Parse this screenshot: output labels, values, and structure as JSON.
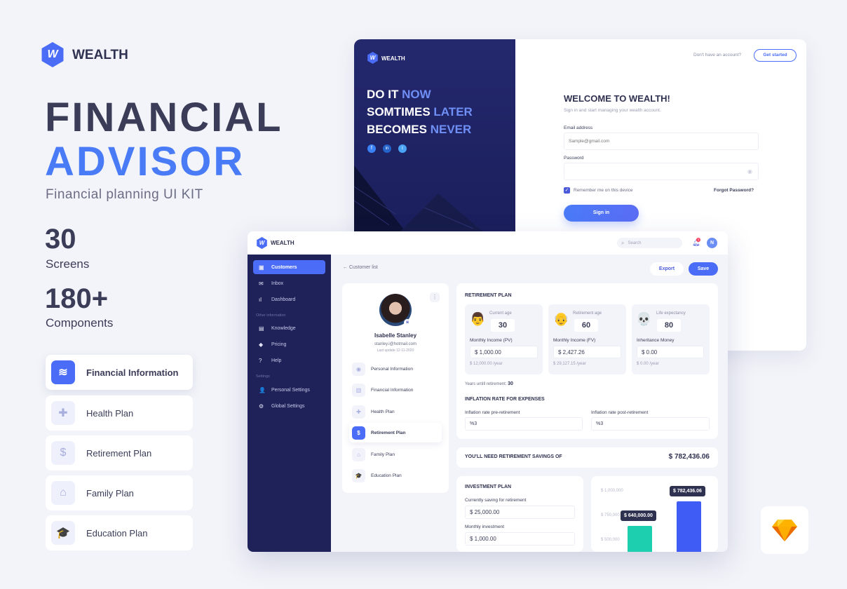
{
  "brand": {
    "name": "WEALTH",
    "logo_letter": "W"
  },
  "hero": {
    "line1": "FINANCIAL",
    "line2": "ADVISOR",
    "tagline": "Financial planning UI KIT",
    "stat1_value": "30",
    "stat1_label": "Screens",
    "stat2_value": "180+",
    "stat2_label": "Components"
  },
  "features": [
    {
      "label": "Financial Information",
      "icon": "coins-icon",
      "active": true
    },
    {
      "label": "Health Plan",
      "icon": "plus-icon"
    },
    {
      "label": "Retirement Plan",
      "icon": "briefcase-dollar-icon"
    },
    {
      "label": "Family Plan",
      "icon": "house-heart-icon"
    },
    {
      "label": "Education Plan",
      "icon": "graduation-cap-icon"
    }
  ],
  "login": {
    "slogan": [
      {
        "white": "DO IT",
        "accent": "NOW"
      },
      {
        "white": "SOMTIMES",
        "accent": "LATER"
      },
      {
        "white": "BECOMES",
        "accent": "NEVER"
      }
    ],
    "no_account": "Don't have an account?",
    "get_started": "Get started",
    "title": "WELCOME TO WEALTH!",
    "subtitle": "Sign in and start managing your wealth account.",
    "email_label": "Email address",
    "email_placeholder": "Sample@gmail.com",
    "password_label": "Password",
    "remember": "Remember me on this device",
    "remember_checked": true,
    "forgot": "Forgot Password?",
    "sign_in": "Sign in",
    "social": [
      "f",
      "in",
      "t"
    ]
  },
  "dashboard": {
    "search_placeholder": "Search",
    "notification_count": "3",
    "avatar_initial": "N",
    "sidebar": {
      "items": [
        {
          "label": "Customers",
          "icon": "user-card-icon",
          "glyph": "▣",
          "active": true
        },
        {
          "label": "Inbox",
          "icon": "mail-icon",
          "glyph": "✉"
        },
        {
          "label": "Dashboard",
          "icon": "bar-chart-icon",
          "glyph": "ıl"
        }
      ],
      "section2": "Other information",
      "items2": [
        {
          "label": "Knowledge",
          "icon": "book-icon",
          "glyph": "▤"
        },
        {
          "label": "Pricing",
          "icon": "tag-icon",
          "glyph": "◆"
        },
        {
          "label": "Help",
          "icon": "help-icon",
          "glyph": "?"
        }
      ],
      "section3": "Settings",
      "items3": [
        {
          "label": "Personal Settings",
          "icon": "user-settings-icon",
          "glyph": "👤"
        },
        {
          "label": "Global Settings",
          "icon": "gear-icon",
          "glyph": "⚙"
        }
      ]
    },
    "back_label": "Customer list",
    "export": "Export",
    "save": "Save",
    "profile": {
      "name": "Isabelle Stanley",
      "email": "stanley.i@hotmail.com",
      "last_update": "Last update 12-11-2020",
      "menu": [
        {
          "label": "Personal Information",
          "glyph": "◉"
        },
        {
          "label": "Financial Information",
          "glyph": "▥"
        },
        {
          "label": "Health Plan",
          "glyph": "✚"
        },
        {
          "label": "Retirement Plan",
          "glyph": "$",
          "active": true
        },
        {
          "label": "Family Plan",
          "glyph": "⌂"
        },
        {
          "label": "Education Plan",
          "glyph": "🎓"
        }
      ]
    },
    "retirement": {
      "title": "RETIREMENT PLAN",
      "tiles": [
        {
          "emoji": "👨",
          "age_label": "Current age",
          "age": "30",
          "income_label": "Monthly Income (PV)",
          "income": "$ 1,000.00",
          "yearly": "$ 12,000.00 /year"
        },
        {
          "emoji": "👴",
          "age_label": "Retirement age",
          "age": "60",
          "income_label": "Monthly Income (FV)",
          "income": "$ 2,427.26",
          "yearly": "$ 29,127.15 /year"
        },
        {
          "emoji": "💀",
          "age_label": "Life expectancy",
          "age": "80",
          "income_label": "Inheritance Money",
          "income": "$ 0.00",
          "yearly": "$ 0.00 /year"
        }
      ],
      "years_label": "Years untill retirement:",
      "years": "30",
      "inflation_title": "INFLATION RATE FOR EXPENSES",
      "pre_label": "Inflation rate pre-retirement",
      "pre": "%3",
      "post_label": "Inflation rate post-retirement",
      "post": "%3"
    },
    "savings": {
      "label": "YOU'LL NEED RETIREMENT SAVINGS OF",
      "value": "$ 782,436.06"
    },
    "investment": {
      "title": "INVESTMENT PLAN",
      "current_label": "Currently saving for retirement",
      "current": "$ 25,000.00",
      "monthly_label": "Monthly investment",
      "monthly": "$ 1,000.00"
    }
  },
  "chart_data": {
    "type": "bar",
    "ticks": [
      "$ 1,000,000",
      "$ 750,000",
      "$ 500,000"
    ],
    "tick_values": [
      1000000,
      750000,
      500000
    ],
    "values": [
      640000,
      782436.06
    ],
    "labels": [
      "$ 640,000.00",
      "$ 782,436.06"
    ],
    "colors": [
      "#1dcfae",
      "#3f5cf5"
    ]
  },
  "colors": {
    "accent": "#4a6cf7",
    "navy": "#1f2259",
    "text": "#3b3d58"
  }
}
